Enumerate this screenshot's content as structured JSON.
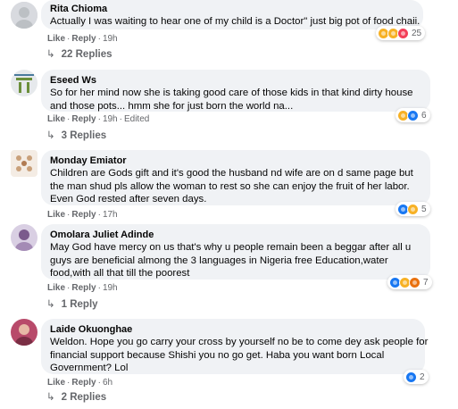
{
  "actions": {
    "like": "Like",
    "reply": "Reply",
    "separator": "·"
  },
  "comments": [
    {
      "author": "Rita Chioma",
      "lines": [
        "Actually I was waiting to hear one of my child is a Doctor\" just big pot of food chaii."
      ],
      "time": "19h",
      "edited": "",
      "reaction_count": "25",
      "reaction_types": [
        "haha",
        "wow",
        "love"
      ],
      "replies_label": "22 Replies"
    },
    {
      "author": "Eseed Ws",
      "lines": [
        "So for her mind now she is taking good care of those kids in that kind dirty house",
        "and those pots... hmm she for just born the world na..."
      ],
      "time": "19h",
      "edited": "Edited",
      "reaction_count": "6",
      "reaction_types": [
        "haha",
        "like"
      ],
      "replies_label": "3 Replies"
    },
    {
      "author": "Monday Emiator",
      "lines": [
        "Children are Gods gift and it's good the husband nd wife are on d same page but",
        "the man shud pls allow the woman to rest so she can enjoy the fruit of her labor.",
        "Even God rested after seven days."
      ],
      "time": "17h",
      "edited": "",
      "reaction_count": "5",
      "reaction_types": [
        "like",
        "haha"
      ],
      "replies_label": ""
    },
    {
      "author": "Omolara Juliet Adinde",
      "lines": [
        "May God have mercy on us that's why u people remain been a beggar after all u",
        "guys are beneficial almong the 3 languages in Nigeria free Education,water",
        "food,with all that till the poorest"
      ],
      "time": "19h",
      "edited": "",
      "reaction_count": "7",
      "reaction_types": [
        "like",
        "haha",
        "angry"
      ],
      "replies_label": "1 Reply"
    },
    {
      "author": "Laide Okuonghae",
      "lines": [
        "Weldon. Hope you go carry your cross by yourself no be to come dey ask people for",
        "financial support because Shishi you no go get. Haba you want born Local",
        "Government? Lol"
      ],
      "time": "6h",
      "edited": "",
      "reaction_count": "2",
      "reaction_types": [
        "like"
      ],
      "replies_label": "2 Replies"
    }
  ]
}
